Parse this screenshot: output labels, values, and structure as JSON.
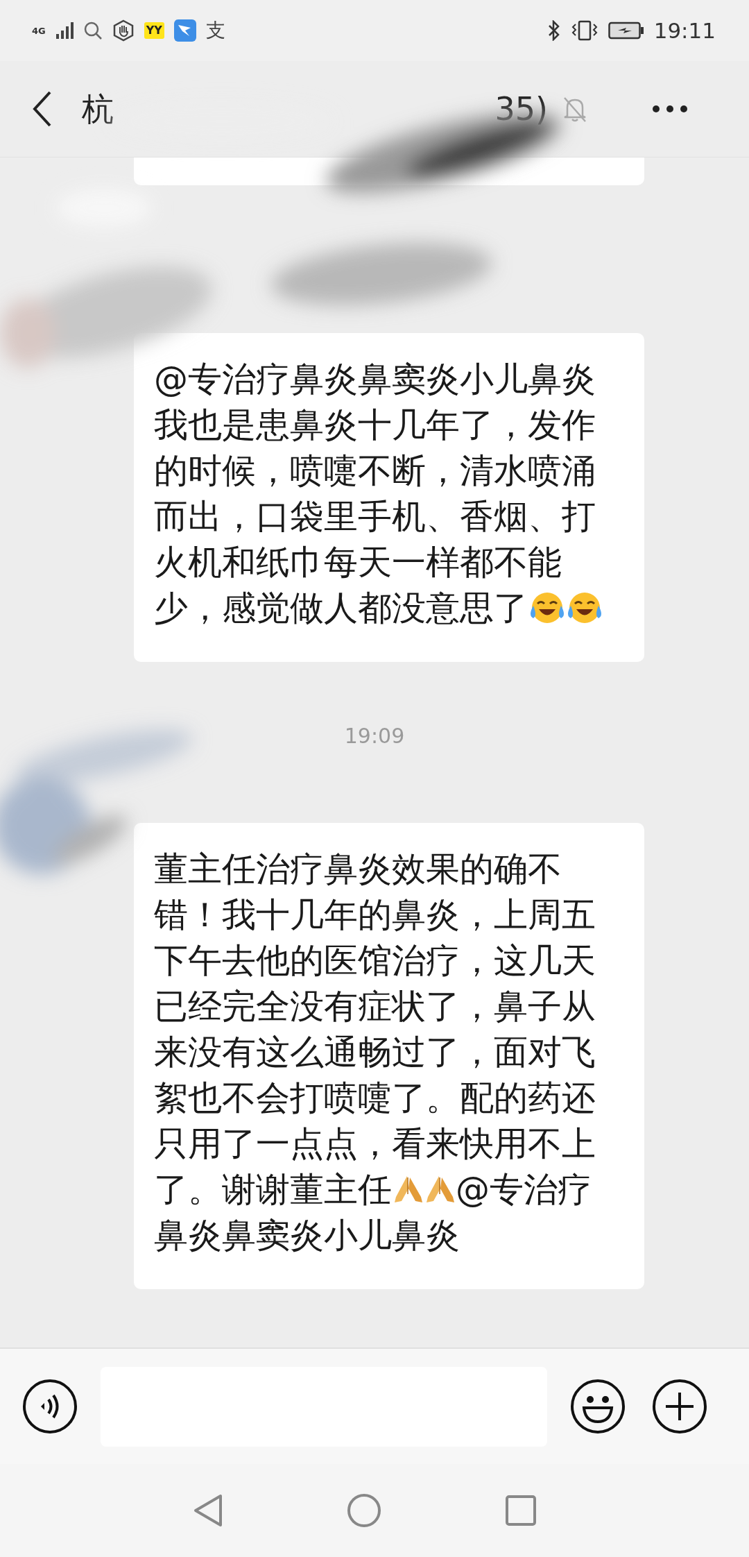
{
  "status_bar": {
    "network": "4G",
    "notifications": [
      {
        "kind": "search"
      },
      {
        "kind": "hand"
      },
      {
        "kind": "badge",
        "text": "YY"
      },
      {
        "kind": "bird"
      },
      {
        "kind": "glyph",
        "text": "支"
      }
    ],
    "time": "19:11"
  },
  "header": {
    "title_start": "杭",
    "title_end": "35)",
    "muted": true
  },
  "messages": [
    {
      "kind": "partial"
    },
    {
      "kind": "bubble",
      "segments": [
        {
          "kind": "text",
          "text": "@专治疗鼻炎鼻窦炎小儿鼻炎我也是患鼻炎十几年了，发作的时候，喷嚏不断，清水喷涌而出，口袋里手机、香烟、打火机和纸巾每天一样都不能少，感觉做人都没意思了"
        },
        {
          "kind": "laughcry"
        },
        {
          "kind": "laughcry"
        }
      ]
    },
    {
      "kind": "time",
      "text": "19:09"
    },
    {
      "kind": "bubble",
      "segments": [
        {
          "kind": "text",
          "text": "董主任治疗鼻炎效果的确不错！我十几年的鼻炎，上周五下午去他的医馆治疗，这几天已经完全没有症状了，鼻子从来没有这么通畅过了，面对飞絮也不会打喷嚏了。配的药还只用了一点点，看来快用不上了。谢谢董主任"
        },
        {
          "kind": "pray"
        },
        {
          "kind": "pray"
        },
        {
          "kind": "text",
          "text": "@专治疗鼻炎鼻窦炎小儿鼻炎"
        }
      ]
    }
  ]
}
